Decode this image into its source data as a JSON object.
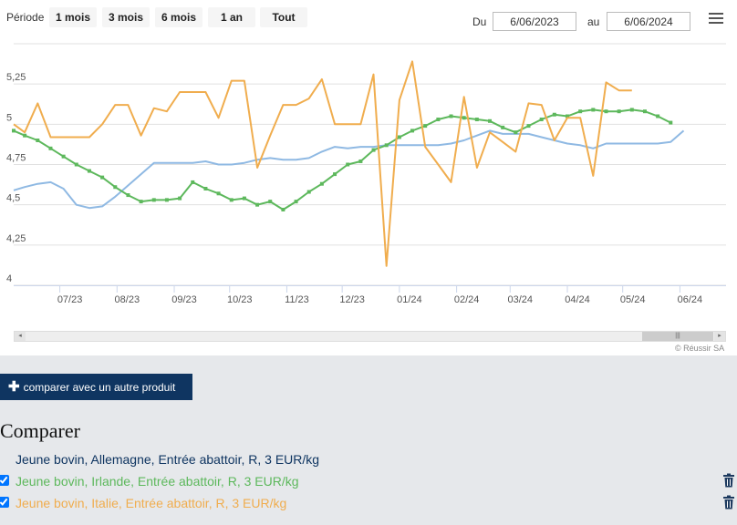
{
  "toolbar": {
    "period_label": "Période",
    "ranges": [
      {
        "label": "1 mois"
      },
      {
        "label": "3 mois"
      },
      {
        "label": "6 mois"
      },
      {
        "label": "1 an"
      },
      {
        "label": "Tout"
      }
    ],
    "from_label": "Du",
    "from_value": "6/06/2023",
    "to_label": "au",
    "to_value": "6/06/2024",
    "menu_icon": "hamburger-icon"
  },
  "credit": "© Réussir SA",
  "compare_button": {
    "label": "comparer avec un autre produit",
    "icon": "plus-icon"
  },
  "compare_title": "Comparer",
  "series_list": [
    {
      "name": "Jeune bovin, Allemagne, Entrée abattoir, R, 3 EUR/kg",
      "checked": false,
      "color": "#0f3561"
    },
    {
      "name": "Jeune bovin, Irlande, Entrée abattoir, R, 3 EUR/kg",
      "checked": true,
      "color": "#5db85c"
    },
    {
      "name": "Jeune bovin, Italie, Entrée abattoir, R, 3 EUR/kg",
      "checked": true,
      "color": "#f0ad4e"
    }
  ],
  "chart_data": {
    "type": "line",
    "x_start": "2023-06-06",
    "x_end": "2024-06-26",
    "ylim": [
      4,
      5.5
    ],
    "yticks": [
      {
        "value": 4,
        "label": "4"
      },
      {
        "value": 4.25,
        "label": "4,25"
      },
      {
        "value": 4.5,
        "label": "4,5"
      },
      {
        "value": 4.75,
        "label": "4,75"
      },
      {
        "value": 5,
        "label": "5"
      },
      {
        "value": 5.25,
        "label": "5,25"
      }
    ],
    "xticks": [
      {
        "date": "2023-07-01",
        "label": "07/23"
      },
      {
        "date": "2023-08-01",
        "label": "08/23"
      },
      {
        "date": "2023-09-01",
        "label": "09/23"
      },
      {
        "date": "2023-10-01",
        "label": "10/23"
      },
      {
        "date": "2023-11-01",
        "label": "11/23"
      },
      {
        "date": "2023-12-01",
        "label": "12/23"
      },
      {
        "date": "2024-01-01",
        "label": "01/24"
      },
      {
        "date": "2024-02-01",
        "label": "02/24"
      },
      {
        "date": "2024-03-01",
        "label": "03/24"
      },
      {
        "date": "2024-04-01",
        "label": "04/24"
      },
      {
        "date": "2024-05-01",
        "label": "05/24"
      },
      {
        "date": "2024-06-01",
        "label": "06/24"
      }
    ],
    "series": [
      {
        "color": "#8fb9e3",
        "markers": false,
        "points": [
          [
            "2023-06-06",
            4.59
          ],
          [
            "2023-06-12",
            4.61
          ],
          [
            "2023-06-19",
            4.63
          ],
          [
            "2023-06-26",
            4.64
          ],
          [
            "2023-07-03",
            4.6
          ],
          [
            "2023-07-10",
            4.5
          ],
          [
            "2023-07-17",
            4.48
          ],
          [
            "2023-07-24",
            4.49
          ],
          [
            "2023-07-31",
            4.55
          ],
          [
            "2023-08-07",
            4.62
          ],
          [
            "2023-08-14",
            4.69
          ],
          [
            "2023-08-21",
            4.76
          ],
          [
            "2023-08-28",
            4.76
          ],
          [
            "2023-09-04",
            4.76
          ],
          [
            "2023-09-11",
            4.76
          ],
          [
            "2023-09-18",
            4.77
          ],
          [
            "2023-09-25",
            4.75
          ],
          [
            "2023-10-02",
            4.75
          ],
          [
            "2023-10-09",
            4.76
          ],
          [
            "2023-10-16",
            4.78
          ],
          [
            "2023-10-23",
            4.79
          ],
          [
            "2023-10-30",
            4.78
          ],
          [
            "2023-11-06",
            4.78
          ],
          [
            "2023-11-13",
            4.79
          ],
          [
            "2023-11-20",
            4.83
          ],
          [
            "2023-11-27",
            4.86
          ],
          [
            "2023-12-04",
            4.85
          ],
          [
            "2023-12-11",
            4.86
          ],
          [
            "2023-12-18",
            4.86
          ],
          [
            "2023-12-25",
            4.87
          ],
          [
            "2024-01-01",
            4.87
          ],
          [
            "2024-01-08",
            4.87
          ],
          [
            "2024-01-15",
            4.87
          ],
          [
            "2024-01-22",
            4.87
          ],
          [
            "2024-01-29",
            4.88
          ],
          [
            "2024-02-05",
            4.9
          ],
          [
            "2024-02-12",
            4.93
          ],
          [
            "2024-02-19",
            4.96
          ],
          [
            "2024-02-26",
            4.94
          ],
          [
            "2024-03-04",
            4.94
          ],
          [
            "2024-03-11",
            4.94
          ],
          [
            "2024-03-18",
            4.92
          ],
          [
            "2024-03-25",
            4.9
          ],
          [
            "2024-04-01",
            4.88
          ],
          [
            "2024-04-08",
            4.87
          ],
          [
            "2024-04-15",
            4.85
          ],
          [
            "2024-04-22",
            4.88
          ],
          [
            "2024-04-29",
            4.88
          ],
          [
            "2024-05-06",
            4.88
          ],
          [
            "2024-05-13",
            4.88
          ],
          [
            "2024-05-20",
            4.88
          ],
          [
            "2024-05-27",
            4.89
          ],
          [
            "2024-06-03",
            4.96
          ]
        ]
      },
      {
        "color": "#5db85c",
        "markers": true,
        "points": [
          [
            "2023-06-06",
            4.96
          ],
          [
            "2023-06-12",
            4.93
          ],
          [
            "2023-06-19",
            4.9
          ],
          [
            "2023-06-26",
            4.85
          ],
          [
            "2023-07-03",
            4.8
          ],
          [
            "2023-07-10",
            4.75
          ],
          [
            "2023-07-17",
            4.71
          ],
          [
            "2023-07-24",
            4.67
          ],
          [
            "2023-07-31",
            4.61
          ],
          [
            "2023-08-07",
            4.56
          ],
          [
            "2023-08-14",
            4.52
          ],
          [
            "2023-08-21",
            4.53
          ],
          [
            "2023-08-28",
            4.53
          ],
          [
            "2023-09-04",
            4.54
          ],
          [
            "2023-09-11",
            4.64
          ],
          [
            "2023-09-18",
            4.6
          ],
          [
            "2023-09-25",
            4.57
          ],
          [
            "2023-10-02",
            4.53
          ],
          [
            "2023-10-09",
            4.54
          ],
          [
            "2023-10-16",
            4.5
          ],
          [
            "2023-10-23",
            4.52
          ],
          [
            "2023-10-30",
            4.47
          ],
          [
            "2023-11-06",
            4.52
          ],
          [
            "2023-11-13",
            4.58
          ],
          [
            "2023-11-20",
            4.63
          ],
          [
            "2023-11-27",
            4.69
          ],
          [
            "2023-12-04",
            4.75
          ],
          [
            "2023-12-11",
            4.77
          ],
          [
            "2023-12-18",
            4.84
          ],
          [
            "2023-12-25",
            4.87
          ],
          [
            "2024-01-01",
            4.92
          ],
          [
            "2024-01-08",
            4.96
          ],
          [
            "2024-01-15",
            4.99
          ],
          [
            "2024-01-22",
            5.03
          ],
          [
            "2024-01-29",
            5.05
          ],
          [
            "2024-02-05",
            5.04
          ],
          [
            "2024-02-12",
            5.03
          ],
          [
            "2024-02-19",
            5.02
          ],
          [
            "2024-02-26",
            4.98
          ],
          [
            "2024-03-04",
            4.95
          ],
          [
            "2024-03-11",
            4.99
          ],
          [
            "2024-03-18",
            5.03
          ],
          [
            "2024-03-25",
            5.06
          ],
          [
            "2024-04-01",
            5.05
          ],
          [
            "2024-04-08",
            5.08
          ],
          [
            "2024-04-15",
            5.09
          ],
          [
            "2024-04-22",
            5.08
          ],
          [
            "2024-04-29",
            5.08
          ],
          [
            "2024-05-06",
            5.09
          ],
          [
            "2024-05-13",
            5.08
          ],
          [
            "2024-05-20",
            5.05
          ],
          [
            "2024-05-27",
            5.01
          ]
        ]
      },
      {
        "color": "#f0ad4e",
        "markers": false,
        "points": [
          [
            "2023-06-06",
            5.0
          ],
          [
            "2023-06-12",
            4.95
          ],
          [
            "2023-06-19",
            5.13
          ],
          [
            "2023-06-26",
            4.92
          ],
          [
            "2023-07-03",
            4.92
          ],
          [
            "2023-07-10",
            4.92
          ],
          [
            "2023-07-17",
            4.92
          ],
          [
            "2023-07-24",
            5.0
          ],
          [
            "2023-07-31",
            5.12
          ],
          [
            "2023-08-07",
            5.12
          ],
          [
            "2023-08-14",
            4.93
          ],
          [
            "2023-08-21",
            5.1
          ],
          [
            "2023-08-28",
            5.08
          ],
          [
            "2023-09-04",
            5.2
          ],
          [
            "2023-09-11",
            5.2
          ],
          [
            "2023-09-18",
            5.2
          ],
          [
            "2023-09-25",
            5.04
          ],
          [
            "2023-10-02",
            5.27
          ],
          [
            "2023-10-09",
            5.27
          ],
          [
            "2023-10-16",
            4.73
          ],
          [
            "2023-10-23",
            4.93
          ],
          [
            "2023-10-30",
            5.12
          ],
          [
            "2023-11-06",
            5.12
          ],
          [
            "2023-11-13",
            5.16
          ],
          [
            "2023-11-20",
            5.28
          ],
          [
            "2023-11-27",
            5.0
          ],
          [
            "2023-12-04",
            5.0
          ],
          [
            "2023-12-11",
            5.0
          ],
          [
            "2023-12-18",
            5.31
          ],
          [
            "2023-12-25",
            4.12
          ],
          [
            "2024-01-01",
            5.15
          ],
          [
            "2024-01-08",
            5.39
          ],
          [
            "2024-01-15",
            4.86
          ],
          [
            "2024-01-22",
            4.75
          ],
          [
            "2024-01-29",
            4.64
          ],
          [
            "2024-02-05",
            5.17
          ],
          [
            "2024-02-12",
            4.73
          ],
          [
            "2024-02-19",
            4.95
          ],
          [
            "2024-02-26",
            4.89
          ],
          [
            "2024-03-04",
            4.83
          ],
          [
            "2024-03-11",
            5.13
          ],
          [
            "2024-03-18",
            5.12
          ],
          [
            "2024-03-25",
            4.9
          ],
          [
            "2024-04-01",
            5.04
          ],
          [
            "2024-04-08",
            5.04
          ],
          [
            "2024-04-15",
            4.68
          ],
          [
            "2024-04-22",
            5.26
          ],
          [
            "2024-04-29",
            5.21
          ],
          [
            "2024-05-06",
            5.21
          ]
        ]
      }
    ]
  }
}
